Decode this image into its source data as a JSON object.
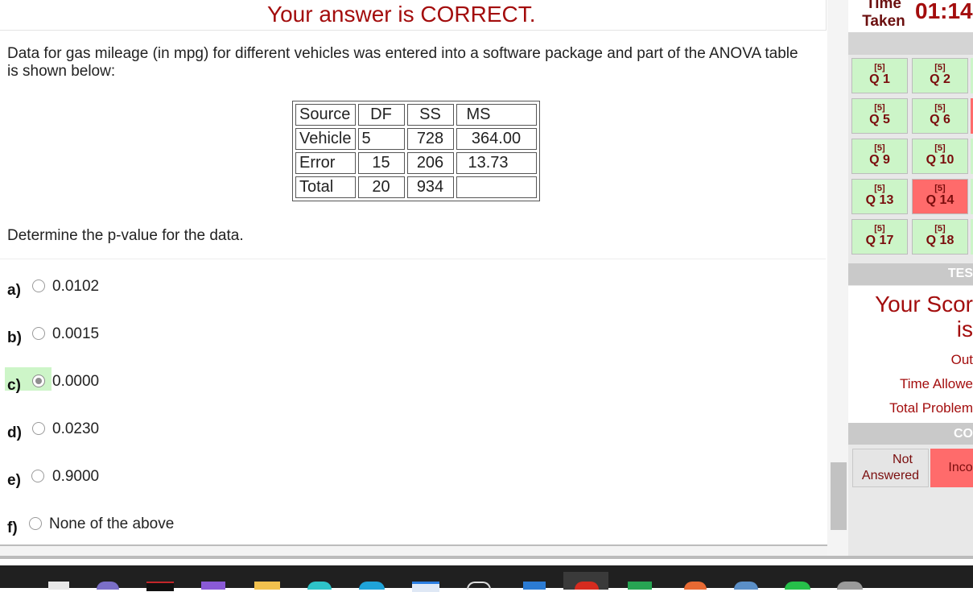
{
  "banner": {
    "status_text": "Your answer is CORRECT."
  },
  "question": {
    "text": "Data for gas mileage (in mpg) for different vehicles was entered into a software package and part of the ANOVA table is shown below:",
    "prompt": "Determine the p-value for the data."
  },
  "anova_table": {
    "headers": [
      "Source",
      "DF",
      "SS",
      "MS"
    ],
    "rows": [
      [
        "Vehicle",
        "5",
        "728",
        "364.00"
      ],
      [
        "Error",
        "15",
        "206",
        "13.73"
      ],
      [
        "Total",
        "20",
        "934",
        ""
      ]
    ]
  },
  "options": [
    {
      "letter": "a)",
      "value": "0.0102",
      "selected": false
    },
    {
      "letter": "b)",
      "value": "0.0015",
      "selected": false
    },
    {
      "letter": "c)",
      "value": "0.0000",
      "selected": true
    },
    {
      "letter": "d)",
      "value": "0.0230",
      "selected": false
    },
    {
      "letter": "e)",
      "value": "0.9000",
      "selected": false
    },
    {
      "letter": "f)",
      "value": "None of the above",
      "selected": false
    }
  ],
  "panel": {
    "time_label": "Time Taken",
    "time_label_line1": "Time",
    "time_label_line2": "Taken",
    "time_value": "01:14",
    "questions": [
      {
        "points": "[5]",
        "label": "Q 1",
        "status": "correct"
      },
      {
        "points": "[5]",
        "label": "Q 2",
        "status": "correct"
      },
      {
        "points": "[5]",
        "label": "Q 5",
        "status": "correct"
      },
      {
        "points": "[5]",
        "label": "Q 6",
        "status": "correct"
      },
      {
        "points": "[5]",
        "label": "Q 9",
        "status": "correct"
      },
      {
        "points": "[5]",
        "label": "Q 10",
        "status": "correct"
      },
      {
        "points": "[5]",
        "label": "Q 13",
        "status": "correct"
      },
      {
        "points": "[5]",
        "label": "Q 14",
        "status": "incorrect"
      },
      {
        "points": "[5]",
        "label": "Q 17",
        "status": "correct"
      },
      {
        "points": "[5]",
        "label": "Q 18",
        "status": "correct"
      }
    ],
    "test_heading": "TES",
    "score_title": "Your Scor",
    "score_is": "is",
    "out_text": "Out",
    "time_allowed": "Time Allowe",
    "total_problems": "Total Problem",
    "color_heading": "CO",
    "legend_not_answered_1": "Not",
    "legend_not_answered_2": "Answered",
    "legend_incorrect": "Inco"
  },
  "colors": {
    "correct": "#ccf5c8",
    "incorrect": "#ff6b6b",
    "accent_red": "#a30d0d"
  }
}
